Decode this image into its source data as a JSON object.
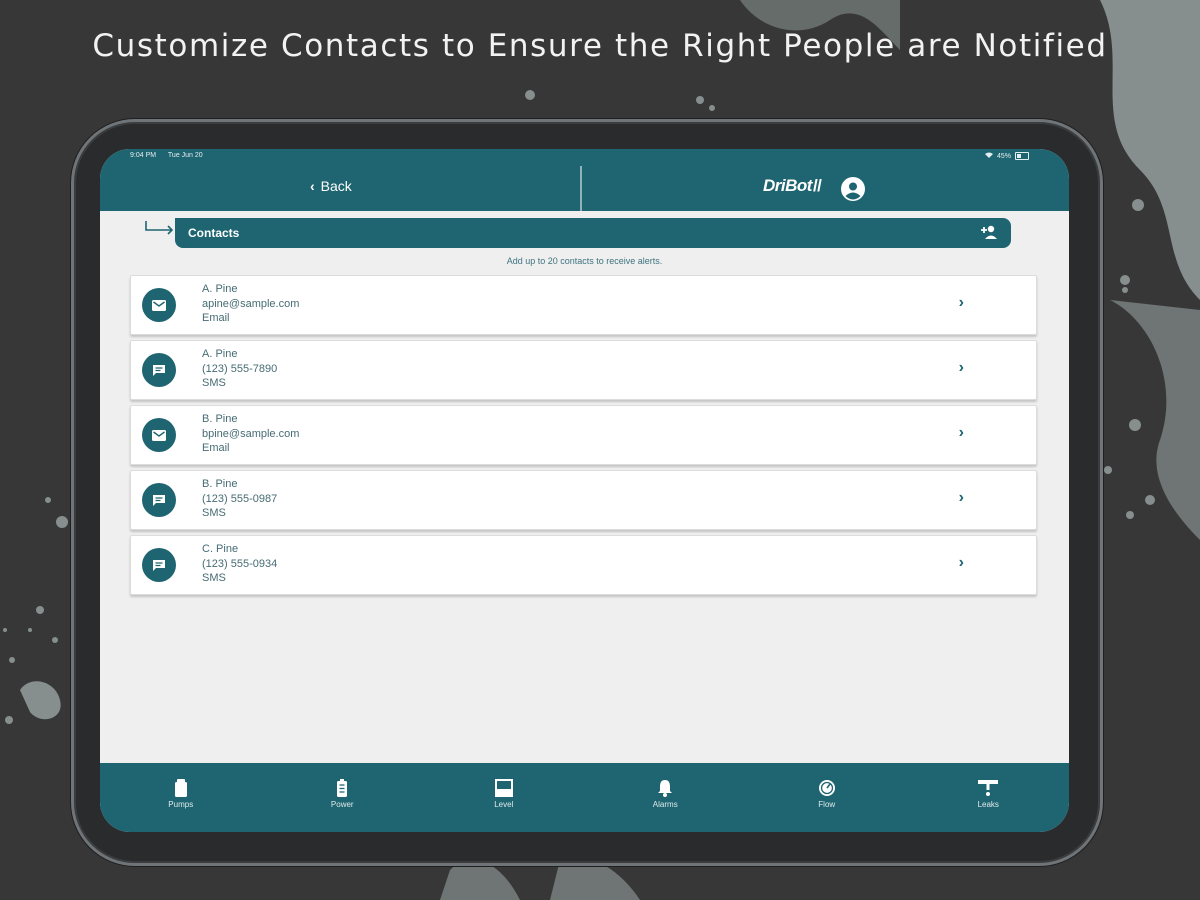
{
  "headline": "Customize Contacts to Ensure the Right People are Notified",
  "status_bar": {
    "time": "9:04 PM",
    "date": "Tue Jun 20",
    "battery": "45%"
  },
  "header": {
    "back_label": "Back",
    "brand": "DriBot",
    "brand_mark": "//"
  },
  "section": {
    "title": "Contacts",
    "hint": "Add up to 20 contacts to receive alerts."
  },
  "contacts": [
    {
      "name": "A. Pine",
      "detail": "apine@sample.com",
      "method": "Email",
      "icon": "mail-icon"
    },
    {
      "name": "A. Pine",
      "detail": "(123) 555-7890",
      "method": "SMS",
      "icon": "message-icon"
    },
    {
      "name": "B. Pine",
      "detail": "bpine@sample.com",
      "method": "Email",
      "icon": "mail-icon"
    },
    {
      "name": "B. Pine",
      "detail": "(123) 555-0987",
      "method": "SMS",
      "icon": "message-icon"
    },
    {
      "name": "C. Pine",
      "detail": "(123) 555-0934",
      "method": "SMS",
      "icon": "message-icon"
    }
  ],
  "tabs": [
    {
      "label": "Pumps",
      "icon": "pump-icon"
    },
    {
      "label": "Power",
      "icon": "battery-icon"
    },
    {
      "label": "Level",
      "icon": "level-icon"
    },
    {
      "label": "Alarms",
      "icon": "bell-icon"
    },
    {
      "label": "Flow",
      "icon": "flow-gauge-icon"
    },
    {
      "label": "Leaks",
      "icon": "leak-icon"
    }
  ],
  "colors": {
    "primary": "#1e6571",
    "background": "#373737",
    "screen": "#efefef"
  }
}
